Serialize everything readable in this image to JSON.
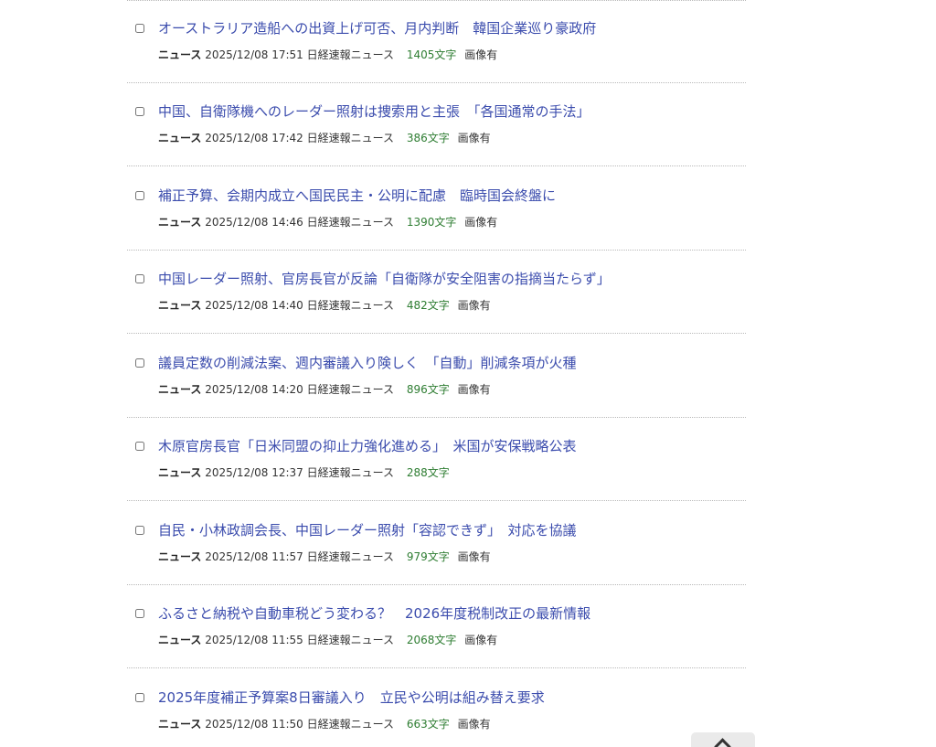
{
  "articles": [
    {
      "title": "オーストラリア造船への出資上げ可否、月内判断　韓国企業巡り豪政府",
      "category": "ニュース",
      "datetime": "2025/12/08 17:51",
      "source": "日経速報ニュース",
      "chars": "1405文字",
      "image_flag": "画像有"
    },
    {
      "title": "中国、自衛隊機へのレーダー照射は捜索用と主張　「各国通常の手法」",
      "category": "ニュース",
      "datetime": "2025/12/08 17:42",
      "source": "日経速報ニュース",
      "chars": "386文字",
      "image_flag": "画像有"
    },
    {
      "title": "補正予算、会期内成立へ国民民主・公明に配慮　臨時国会終盤に",
      "category": "ニュース",
      "datetime": "2025/12/08 14:46",
      "source": "日経速報ニュース",
      "chars": "1390文字",
      "image_flag": "画像有"
    },
    {
      "title": "中国レーダー照射、官房長官が反論「自衛隊が安全阻害の指摘当たらず」",
      "category": "ニュース",
      "datetime": "2025/12/08 14:40",
      "source": "日経速報ニュース",
      "chars": "482文字",
      "image_flag": "画像有"
    },
    {
      "title": "議員定数の削減法案、週内審議入り険しく　「自動」削減条項が火種",
      "category": "ニュース",
      "datetime": "2025/12/08 14:20",
      "source": "日経速報ニュース",
      "chars": "896文字",
      "image_flag": "画像有"
    },
    {
      "title": "木原官房長官「日米同盟の抑止力強化進める」　米国が安保戦略公表",
      "category": "ニュース",
      "datetime": "2025/12/08 12:37",
      "source": "日経速報ニュース",
      "chars": "288文字",
      "image_flag": ""
    },
    {
      "title": "自民・小林政調会長、中国レーダー照射「容認できず」　対応を協議",
      "category": "ニュース",
      "datetime": "2025/12/08 11:57",
      "source": "日経速報ニュース",
      "chars": "979文字",
      "image_flag": "画像有"
    },
    {
      "title": "ふるさと納税や自動車税どう変わる？　2026年度税制改正の最新情報",
      "category": "ニュース",
      "datetime": "2025/12/08 11:55",
      "source": "日経速報ニュース",
      "chars": "2068文字",
      "image_flag": "画像有"
    },
    {
      "title": "2025年度補正予算案8日審議入り　立民や公明は組み替え要求",
      "category": "ニュース",
      "datetime": "2025/12/08 11:50",
      "source": "日経速報ニュース",
      "chars": "663文字",
      "image_flag": "画像有"
    }
  ],
  "colors": {
    "title_link": "#3b4cad",
    "char_count": "#2e7d32",
    "divider": "#b8b8b8"
  },
  "back_to_top": {
    "icon": "chevron-up-icon"
  }
}
